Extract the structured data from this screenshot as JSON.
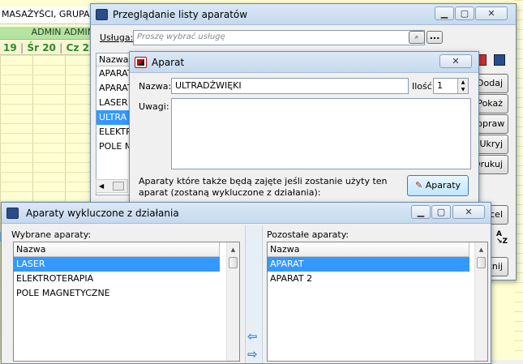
{
  "background": {
    "header_text": "MASAŻYŚCI, GRUPA ...",
    "admin_text": "ADMIN ADMIN",
    "day_labels": [
      "19",
      "Śr 20",
      "Cz 2"
    ]
  },
  "window_list": {
    "title": "Przeglądanie listy aparatów",
    "service_label": "Usługa:",
    "service_placeholder": "Proszę wybrać usługę",
    "browse_label": "...",
    "column_name": "Nazwa",
    "rows": [
      "APARAT",
      "APARAT",
      "LASER",
      "ULTRA",
      "ELEKTR",
      "POLE M"
    ],
    "selected_row": 3,
    "side_buttons": [
      "Dodaj",
      "Pokaż",
      "Popraw",
      "Ukryj",
      "Drukuj"
    ],
    "cancel_button": "cel",
    "close_button": "knij"
  },
  "window_aparat": {
    "title": "Aparat",
    "name_label": "Nazwa:",
    "name_value": "ULTRADŹWIĘKI",
    "qty_label": "Ilość:",
    "qty_value": "1",
    "notes_label": "Uwagi:",
    "notes_value": "",
    "info_text_1": "Aparaty które także będą zajęte jeśli zostanie użyty ten",
    "info_text_2": "aparat (zostaną wykluczone z działania):",
    "aparaty_button": "Aparaty"
  },
  "window_excluded": {
    "title": "Aparaty wykluczone z działania",
    "selected_label": "Wybrane aparaty:",
    "remaining_label": "Pozostałe aparaty:",
    "column_name": "Nazwa",
    "selected_items": [
      "LASER",
      "ELEKTROTERAPIA",
      "POLE MAGNETYCZNE"
    ],
    "remaining_items": [
      "APARAT",
      "APARAT 2"
    ],
    "selected_active_row": 0,
    "remaining_active_row": 0
  },
  "colors": {
    "selection": "#3399ff",
    "schedule_bg": "#fefed2",
    "admin_bar": "#b5e3a0",
    "day_text": "#2d8a2d"
  }
}
